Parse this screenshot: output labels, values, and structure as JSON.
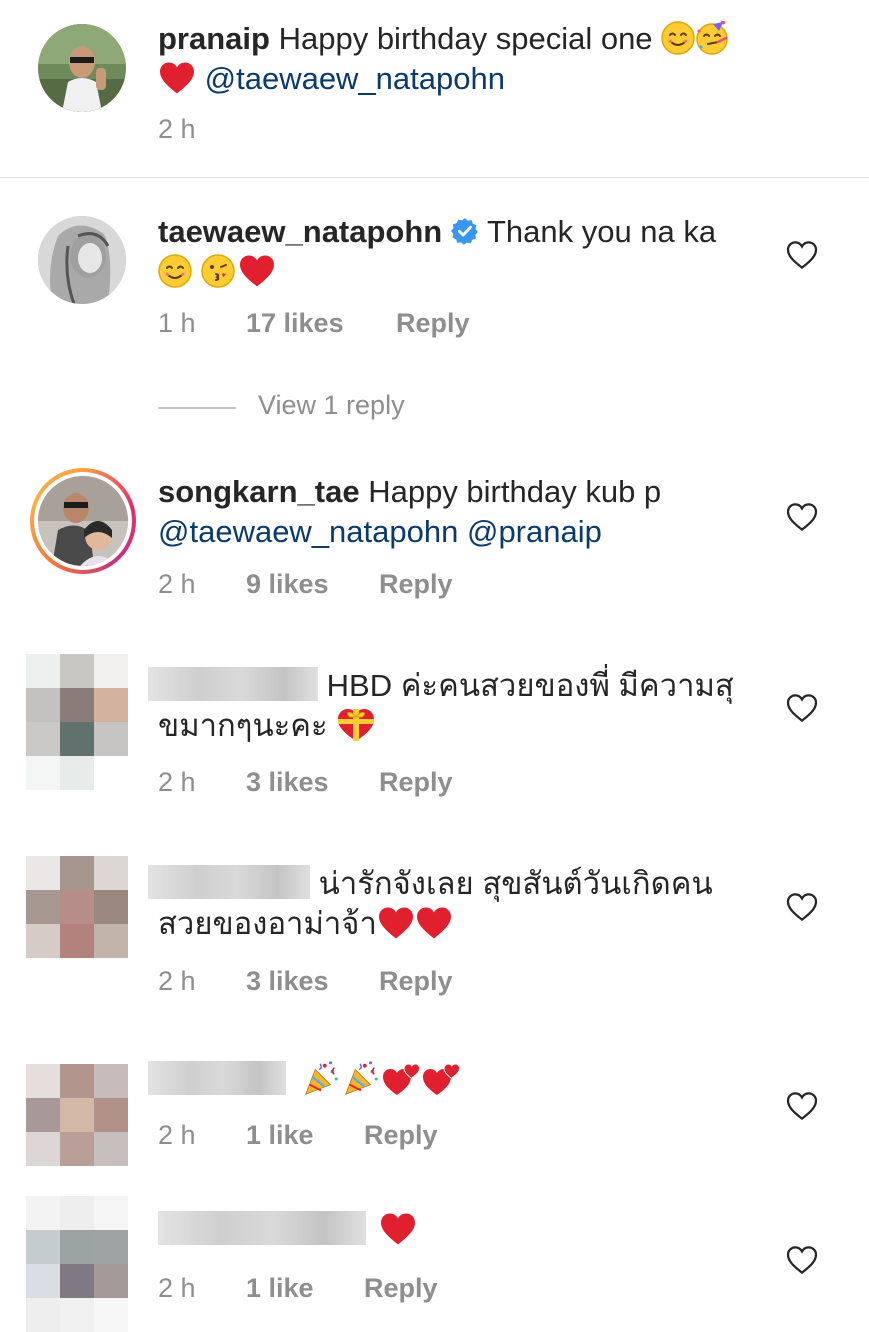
{
  "comments": [
    {
      "username": "pranaip",
      "text": "Happy birthday special one",
      "mention": "@taewaew_natapohn",
      "time": "2 h"
    },
    {
      "username": "taewaew_natapohn",
      "verified": true,
      "text": "Thank you na ka",
      "time": "1 h",
      "likes": "17 likes",
      "reply": "Reply",
      "view_replies": "View 1 reply"
    },
    {
      "username": "songkarn_tae",
      "text": "Happy birthday kub p",
      "mentions": "@taewaew_natapohn @pranaip",
      "time": "2 h",
      "likes": "9 likes",
      "reply": "Reply"
    },
    {
      "text": "HBD ค่ะคนสวยของพี่ มีความสุ",
      "text2": "ขมากๆนะคะ",
      "time": "2 h",
      "likes": "3 likes",
      "reply": "Reply"
    },
    {
      "text": "น่ารักจังเลย สุขสันต์วันเกิดคน",
      "text2": "สวยของอาม่าจ้า",
      "time": "2 h",
      "likes": "3 likes",
      "reply": "Reply"
    },
    {
      "time": "2 h",
      "likes": "1 like",
      "reply": "Reply"
    },
    {
      "time": "2 h",
      "likes": "1 like",
      "reply": "Reply"
    }
  ],
  "icons": {
    "like": "heart-outline-icon",
    "verified": "verified-badge-icon"
  },
  "colors": {
    "mention": "#0b3a6e",
    "heart": "#e0202e",
    "verified": "#3897f0",
    "meta": "#8e8e8e"
  }
}
